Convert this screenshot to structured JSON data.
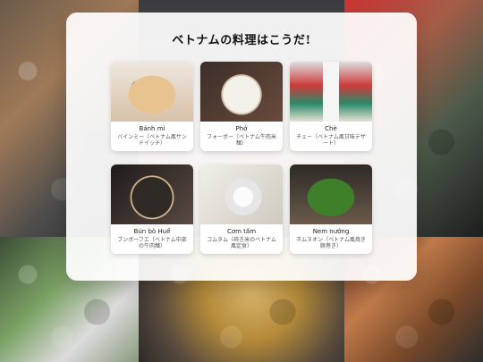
{
  "page": {
    "title": "ベトナムの料理はこうだ!"
  },
  "dishes": [
    {
      "name": "Bánh mì",
      "desc": "バインミー（ベトナム風サンドイッチ）",
      "icon": "banh-mi-photo"
    },
    {
      "name": "Phở",
      "desc": "フォーボー（ベトナム牛肉米麺）",
      "icon": "pho-photo"
    },
    {
      "name": "Chè",
      "desc": "チェー（ベトナム風甘味デザート）",
      "icon": "che-photo"
    },
    {
      "name": "Bún bò Huế",
      "desc": "ブンボーフエ（ベトナム中部の牛肉麺）",
      "icon": "bun-bo-hue-photo"
    },
    {
      "name": "Cơm tấm",
      "desc": "コムタム（砕き米のベトナム風定食）",
      "icon": "com-tam-photo"
    },
    {
      "name": "Nem nướng",
      "desc": "ネムヌオン（ベトナム風焼き豚巻き）",
      "icon": "nem-nuong-photo"
    }
  ]
}
